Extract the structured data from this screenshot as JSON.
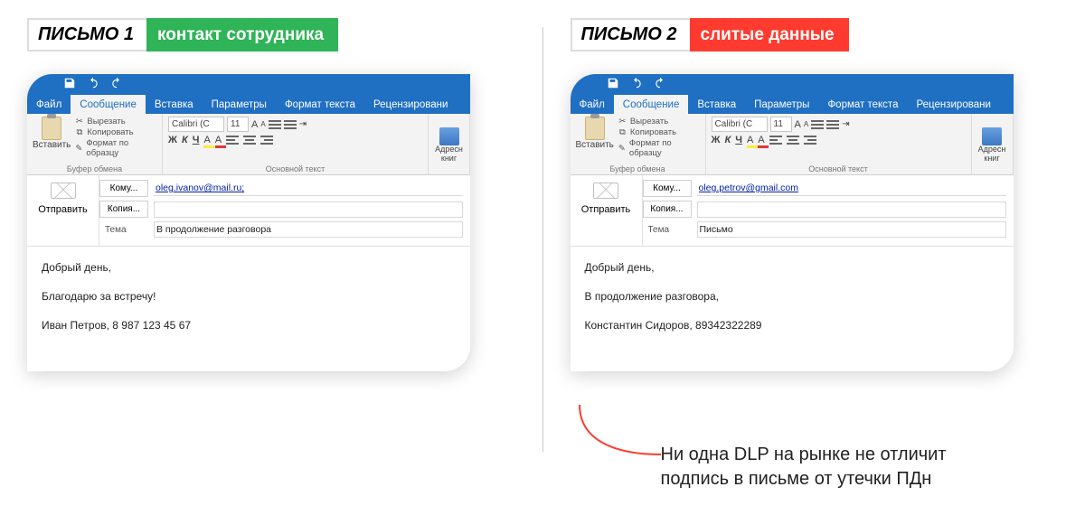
{
  "left": {
    "badge": "ПИСЬМО 1",
    "subtitle": "контакт сотрудника",
    "ribbonTabs": {
      "file": "Файл",
      "message": "Сообщение",
      "insert": "Вставка",
      "options": "Параметры",
      "format": "Формат текста",
      "review": "Рецензировани"
    },
    "clipboard": {
      "paste": "Вставить",
      "cut": "Вырезать",
      "copy": "Копировать",
      "formatPainter": "Формат по образцу",
      "groupLabel": "Буфер обмена"
    },
    "font": {
      "name": "Calibri (С",
      "size": "11",
      "groupLabel": "Основной текст"
    },
    "address": {
      "label1": "Адресн",
      "label2": "книг"
    },
    "compose": {
      "send": "Отправить",
      "toBtn": "Кому...",
      "ccBtn": "Копия...",
      "subjectLabel": "Тема",
      "to": "oleg.ivanov@mail.ru;",
      "cc": "",
      "subject": "В продолжение разговора"
    },
    "body": {
      "l1": "Добрый день,",
      "l2": "Благодарю за встречу!",
      "l3": "Иван Петров, 8 987 123 45 67"
    }
  },
  "right": {
    "badge": "ПИСЬМО 2",
    "subtitle": "слитые данные",
    "ribbonTabs": {
      "file": "Файл",
      "message": "Сообщение",
      "insert": "Вставка",
      "options": "Параметры",
      "format": "Формат текста",
      "review": "Рецензировани"
    },
    "clipboard": {
      "paste": "Вставить",
      "cut": "Вырезать",
      "copy": "Копировать",
      "formatPainter": "Формат по образцу",
      "groupLabel": "Буфер обмена"
    },
    "font": {
      "name": "Calibri (С",
      "size": "11",
      "groupLabel": "Основной текст"
    },
    "address": {
      "label1": "Адресн",
      "label2": "книг"
    },
    "compose": {
      "send": "Отправить",
      "toBtn": "Кому...",
      "ccBtn": "Копия...",
      "subjectLabel": "Тема",
      "to": "oleg.petrov@gmail.com",
      "cc": "",
      "subject": "Письмо"
    },
    "body": {
      "l1": "Добрый день,",
      "l2": "В продолжение разговора,",
      "l3": "Константин Сидоров, 89342322289"
    }
  },
  "caption": {
    "line1": "Ни одна DLP на рынке не отличит",
    "line2": "подпись в письме от утечки ПДн"
  }
}
